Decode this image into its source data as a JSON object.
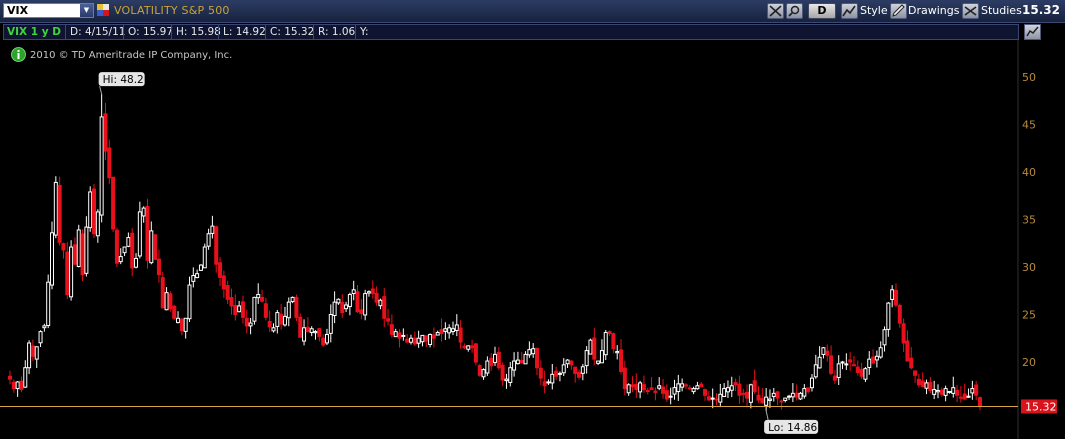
{
  "toolbar": {
    "symbol": "VIX",
    "description": "VOLATILITY S&P 500",
    "period_button": "D",
    "style_label": "Style",
    "drawings_label": "Drawings",
    "studies_label": "Studies",
    "last_price": "15.32"
  },
  "infobar": {
    "chart_label": "VIX 1 y D",
    "date": "D: 4/15/11",
    "open": "O: 15.97",
    "high": "H: 15.98",
    "low": "L: 14.92",
    "close": "C: 15.32",
    "range": "R: 1.06",
    "y": "Y:"
  },
  "copyright": "2010 © TD Ameritrade IP Company, Inc.",
  "colors": {
    "up": "#ffffff",
    "down": "#e8101a",
    "price_line": "#d9a440",
    "axis_text": "#b88a3c",
    "accent_green": "#3fd53f"
  },
  "chart_data": {
    "type": "candlestick",
    "title": "VOLATILITY S&P 500",
    "xlabel": "",
    "ylabel": "",
    "ylim": [
      14,
      54
    ],
    "y_ticks": [
      20,
      25,
      30,
      35,
      40,
      45,
      50
    ],
    "grid": false,
    "hi_label": "Hi: 48.2",
    "lo_label": "Lo: 14.86",
    "last_label": "15.32",
    "last_value": 15.32,
    "hi_value": 48.2,
    "lo_value": 14.86,
    "hi_index": 24,
    "lo_index": 198,
    "closes": [
      18.2,
      17.2,
      17.9,
      17.1,
      19.4,
      22.0,
      20.6,
      21.6,
      23.2,
      23.8,
      28.4,
      33.6,
      38.9,
      32.6,
      31.8,
      27.1,
      32.1,
      30.3,
      33.9,
      29.2,
      34.2,
      37.9,
      33.5,
      35.8,
      45.8,
      42.2,
      39.4,
      34.0,
      30.4,
      31.1,
      32.1,
      33.1,
      29.9,
      30.9,
      35.8,
      36.2,
      30.7,
      33.8,
      30.8,
      29.2,
      25.7,
      27.3,
      25.6,
      24.6,
      24.6,
      23.3,
      24.6,
      28.1,
      29.1,
      29.3,
      30.2,
      32.1,
      33.5,
      34.3,
      30.3,
      28.9,
      27.7,
      26.6,
      25.9,
      25.0,
      25.9,
      24.7,
      23.8,
      24.1,
      26.8,
      27.1,
      26.4,
      24.7,
      23.7,
      23.6,
      25.2,
      24.0,
      24.8,
      26.3,
      26.8,
      24.7,
      22.6,
      23.6,
      23.2,
      23.5,
      23.2,
      22.7,
      21.8,
      22.9,
      25.0,
      26.3,
      26.6,
      25.2,
      26.0,
      27.1,
      27.6,
      25.3,
      25.1,
      27.2,
      27.4,
      27.2,
      26.3,
      26.5,
      24.6,
      24.3,
      22.9,
      23.2,
      22.5,
      22.8,
      22.1,
      22.5,
      21.9,
      22.5,
      22.8,
      22.2,
      22.9,
      22.5,
      23.1,
      23.0,
      23.5,
      23.6,
      23.5,
      23.9,
      22.1,
      21.5,
      21.7,
      21.5,
      20.0,
      18.6,
      19.2,
      20.1,
      19.6,
      20.8,
      19.4,
      18.1,
      18.2,
      19.4,
      20.1,
      20.2,
      19.9,
      20.8,
      21.3,
      21.4,
      19.4,
      18.3,
      17.5,
      17.9,
      18.7,
      18.5,
      18.8,
      19.7,
      20.2,
      19.7,
      18.8,
      18.4,
      19.5,
      21.2,
      22.3,
      20.3,
      20.1,
      21.2,
      23.1,
      23.0,
      21.4,
      21.1,
      19.0,
      17.2,
      17.6,
      17.4,
      17.1,
      17.8,
      17.1,
      16.9,
      17.1,
      16.8,
      17.5,
      16.7,
      16.1,
      16.4,
      17.3,
      17.7,
      17.7,
      17.5,
      17.2,
      17.2,
      17.5,
      17.4,
      16.5,
      16.0,
      16.2,
      16.1,
      16.6,
      17.2,
      17.3,
      17.5,
      17.6,
      16.5,
      16.6,
      16.2,
      17.6,
      16.9,
      16.0,
      15.7,
      16.3,
      16.1,
      16.7,
      16.2,
      15.8,
      16.2,
      16.4,
      16.7,
      16.3,
      16.7,
      17.2,
      16.9,
      18.3,
      19.7,
      20.5,
      21.5,
      20.7,
      18.8,
      18.1,
      19.8,
      20.0,
      19.8,
      20.0,
      19.6,
      18.9,
      18.5,
      19.3,
      20.3,
      19.9,
      20.6,
      21.5,
      23.4,
      26.2,
      27.6,
      26.0,
      24.1,
      22.0,
      20.1,
      19.4,
      18.6,
      17.6,
      17.4,
      17.8,
      17.0,
      17.1,
      17.0,
      16.6,
      17.2,
      16.9,
      17.3,
      16.5,
      16.2,
      16.1,
      16.4,
      17.2,
      16.5,
      15.3
    ]
  }
}
